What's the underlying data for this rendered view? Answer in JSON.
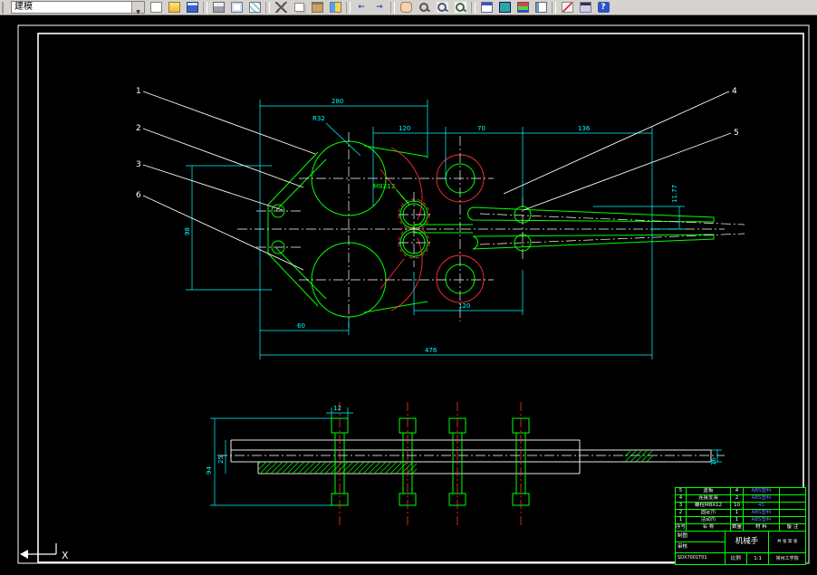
{
  "toolbar": {
    "dropdown_value": "建模",
    "icon_groups": [
      [
        "new-file",
        "open",
        "save"
      ],
      [
        "plot",
        "plot-preview",
        "publish"
      ],
      [
        "cut",
        "copy",
        "paste",
        "match-properties"
      ],
      [
        "undo",
        "redo"
      ],
      [
        "pan",
        "zoom-realtime",
        "zoom-window",
        "zoom-previous"
      ],
      [
        "properties",
        "design-center",
        "tool-palettes",
        "sheet-set-manager"
      ],
      [
        "markup",
        "quick-calc",
        "help"
      ]
    ]
  },
  "colors": {
    "geometry": "#00ff00",
    "dimension": "#00ffff",
    "hidden": "#ff3232",
    "centerline": "#ffffff",
    "background": "#000000",
    "toolbar_bg": "#d6d3ce"
  },
  "canvas": {
    "ucs_x_label": "X",
    "balloons": {
      "n1": "1",
      "n2": "2",
      "n3": "3",
      "n6": "6",
      "n4": "4",
      "n5": "5"
    },
    "dims": {
      "top_280": "280",
      "top_120": "120",
      "top_70": "70",
      "top_136": "136",
      "left_98": "98",
      "radius_r32": "R32",
      "thread_m8": "M8X12",
      "bot_60": "60",
      "bot_120": "120",
      "bot_476": "476",
      "right_1177": "11.77",
      "sec_12": "12",
      "sec_25": "25",
      "sec_94": "94",
      "sec_16": "16"
    }
  },
  "title_block": {
    "rows": [
      {
        "no": "5",
        "name": "盖板",
        "qty": "4",
        "material": "ABS塑料",
        "note": ""
      },
      {
        "no": "4",
        "name": "连接支架",
        "qty": "2",
        "material": "ABS塑料",
        "note": ""
      },
      {
        "no": "3",
        "name": "螺栓M8X12",
        "qty": "10",
        "material": "45",
        "note": ""
      },
      {
        "no": "2",
        "name": "固定爪",
        "qty": "1",
        "material": "ABS塑料",
        "note": ""
      },
      {
        "no": "1",
        "name": "活动爪",
        "qty": "1",
        "material": "ABS塑料",
        "note": ""
      }
    ],
    "header": {
      "no": "序号",
      "name": "名 称",
      "qty": "数量",
      "material": "材 料",
      "note": "备 注"
    },
    "part_name": "机械手",
    "scale_label": "比例",
    "scale_value": "1:1",
    "sheets": "共 张 第 张",
    "org": "常州工学院",
    "drafter": "制图",
    "checker": "审核",
    "doc_no": "SDX7001T01"
  }
}
